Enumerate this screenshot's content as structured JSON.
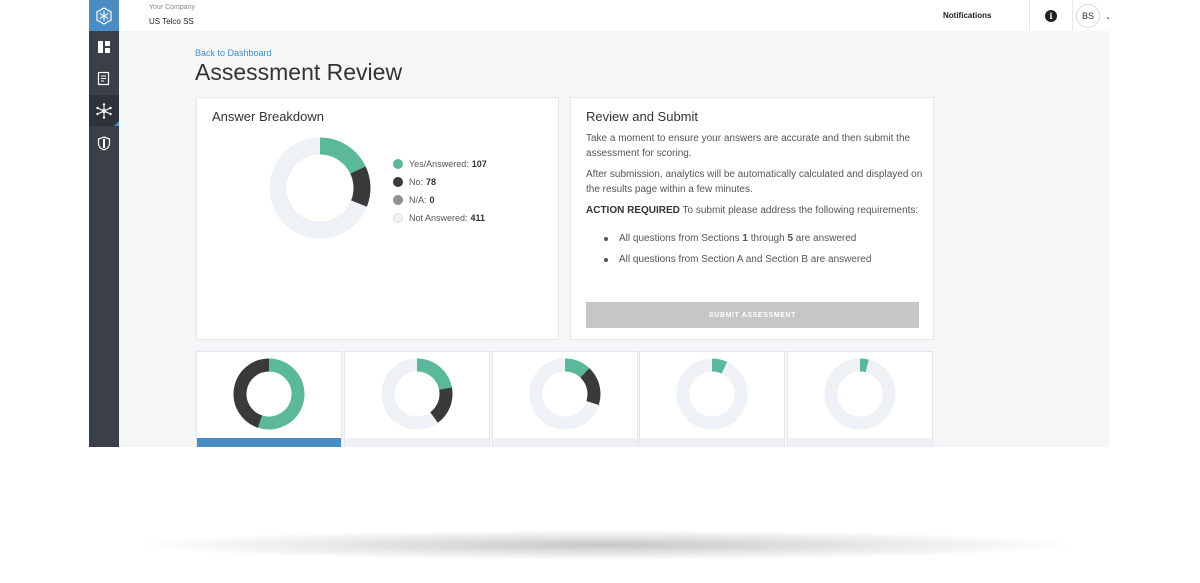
{
  "header": {
    "company_label": "Your Company",
    "company_name": "US Telco SS",
    "notifications_label": "Notifications",
    "info_glyph": "i",
    "user_initials": "BS"
  },
  "sidebar": {
    "items": [
      {
        "icon": "snowflake-logo-icon"
      },
      {
        "icon": "dashboard-icon"
      },
      {
        "icon": "document-icon"
      },
      {
        "icon": "network-icon",
        "active": true
      },
      {
        "icon": "shield-icon"
      }
    ]
  },
  "page": {
    "back_link": "Back to Dashboard",
    "title": "Assessment Review"
  },
  "breakdown": {
    "title": "Answer Breakdown",
    "legend": [
      {
        "label": "Yes/Answered:",
        "value": "107",
        "color": "#5cb89a"
      },
      {
        "label": "No:",
        "value": "78",
        "color": "#3a3a3a"
      },
      {
        "label": "N/A:",
        "value": "0",
        "color": "#8a8f96"
      },
      {
        "label": "Not Answered:",
        "value": "411",
        "color": "#eef1f5"
      }
    ]
  },
  "chart_data": {
    "type": "pie",
    "title": "Answer Breakdown",
    "categories": [
      "Yes/Answered",
      "No",
      "N/A",
      "Not Answered"
    ],
    "values": [
      107,
      78,
      0,
      411
    ],
    "colors": [
      "#5cb89a",
      "#3a3a3a",
      "#8a8f96",
      "#eef1f5"
    ]
  },
  "mini_charts": [
    {
      "yes": 0.55,
      "no": 0.45,
      "active": true
    },
    {
      "yes": 0.22,
      "no": 0.18,
      "active": false
    },
    {
      "yes": 0.12,
      "no": 0.18,
      "active": false
    },
    {
      "yes": 0.07,
      "no": 0.0,
      "active": false
    },
    {
      "yes": 0.04,
      "no": 0.0,
      "active": false
    }
  ],
  "review": {
    "title": "Review and Submit",
    "paragraph1": "Take a moment to ensure your answers are accurate and then submit the assessment for scoring.",
    "paragraph2": "After submission, analytics will be automatically calculated and displayed on the results page within a few minutes.",
    "action_label": "ACTION REQUIRED",
    "action_text": "To submit please address the following requirements:",
    "requirements": [
      {
        "pre": "All questions from Sections ",
        "b1": "1",
        "mid": " through ",
        "b2": "5",
        "post": " are answered"
      },
      {
        "pre": "All questions from Section ",
        "b1": "A",
        "mid": " and Section ",
        "b2": "B",
        "post": " are answered"
      }
    ],
    "submit_label": "SUBMIT ASSESSMENT"
  },
  "colors": {
    "accent": "#4a8dc3",
    "yes": "#5cb89a",
    "no": "#3a3a3a",
    "track": "#eef1f5",
    "sidebar": "#3a3f48"
  }
}
